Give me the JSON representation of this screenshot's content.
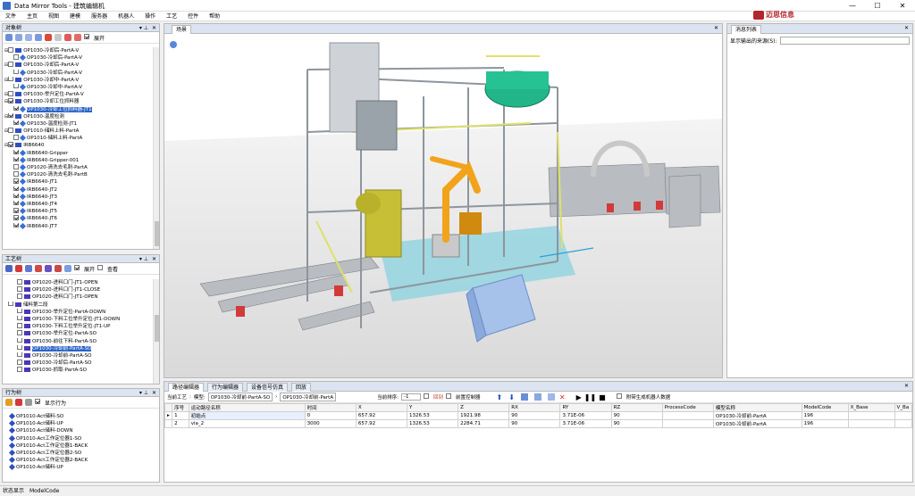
{
  "window": {
    "title": "Data Mirror Tools - 建筑编辑机",
    "min": "—",
    "max": "☐",
    "close": "✕"
  },
  "menu": [
    "文件",
    "主页",
    "视图",
    "建模",
    "服务器",
    "机器人",
    "操作",
    "工艺",
    "控件",
    "帮助"
  ],
  "logo_text": "迈思信息",
  "object_tree": {
    "title": "对象树",
    "show_label": "展开",
    "items": [
      {
        "text": "OP1030-冷却后-PartA-V",
        "check": false,
        "kind": "fold",
        "indent": 0
      },
      {
        "text": "OP1030-冷却后-PartA-V",
        "check": false,
        "kind": "dia",
        "indent": 1
      },
      {
        "text": "OP1030-冷却后-PartA-V",
        "check": false,
        "kind": "fold",
        "indent": 0
      },
      {
        "text": "OP1030-冷却后-PartA-V",
        "check": false,
        "kind": "dia",
        "indent": 1
      },
      {
        "text": "OP1030-冷却中-PartA-V",
        "check": false,
        "kind": "fold",
        "indent": 0
      },
      {
        "text": "OP1030-冷却中-PartA-V",
        "check": false,
        "kind": "dia",
        "indent": 1
      },
      {
        "text": "OP1030-举升定位-PartA-V",
        "check": false,
        "kind": "fold",
        "indent": 0
      },
      {
        "text": "OP1030-冷却工位抓料器",
        "check": true,
        "kind": "fold",
        "indent": 0
      },
      {
        "text": "OP1030-冷却工位抓料器-JT1",
        "check": true,
        "kind": "dia",
        "indent": 1,
        "selected": true
      },
      {
        "text": "OP1030-温度检测",
        "check": true,
        "kind": "fold",
        "indent": 0
      },
      {
        "text": "OP1030-温度检测-JT1",
        "check": true,
        "kind": "dia",
        "indent": 1
      },
      {
        "text": "OP1010-储料上料-PartA",
        "check": false,
        "kind": "fold",
        "indent": 0
      },
      {
        "text": "OP1010-储料上料-PartA",
        "check": false,
        "kind": "dia",
        "indent": 1
      },
      {
        "text": "IRB6640",
        "check": true,
        "kind": "fold",
        "indent": 0
      },
      {
        "text": "IRB6640-Gripper",
        "check": true,
        "kind": "dia",
        "indent": 1
      },
      {
        "text": "IRB6640-Gripper-001",
        "check": true,
        "kind": "dia",
        "indent": 1
      },
      {
        "text": "OP1020-清洗去毛刺-PartA",
        "check": false,
        "kind": "dia",
        "indent": 1
      },
      {
        "text": "OP1020-清洗去毛刺-PartB",
        "check": false,
        "kind": "dia",
        "indent": 1
      },
      {
        "text": "IRB6640-JT1",
        "check": true,
        "kind": "dia",
        "indent": 1
      },
      {
        "text": "IRB6640-JT2",
        "check": true,
        "kind": "dia",
        "indent": 1
      },
      {
        "text": "IRB6640-JT3",
        "check": true,
        "kind": "dia",
        "indent": 1
      },
      {
        "text": "IRB6640-JT4",
        "check": true,
        "kind": "dia",
        "indent": 1
      },
      {
        "text": "IRB6640-JT5",
        "check": true,
        "kind": "dia",
        "indent": 1
      },
      {
        "text": "IRB6640-JT6",
        "check": true,
        "kind": "dia",
        "indent": 1
      },
      {
        "text": "IRB6640-JT7",
        "check": true,
        "kind": "dia",
        "indent": 1
      }
    ]
  },
  "process_tree": {
    "title": "工艺树",
    "expand_label": "展开",
    "view_label": "查看",
    "items": [
      {
        "text": "OP1020-进料口门-JT1-OPEN",
        "indent": 1
      },
      {
        "text": "OP1020-进料口门-JT1-CLOSE",
        "indent": 1
      },
      {
        "text": "OP1020-进料口门-JT1-OPEN",
        "indent": 1
      },
      {
        "text": "储料第二段",
        "indent": 0
      },
      {
        "text": "OP1030-举升定位-PartA-DOWN",
        "indent": 1
      },
      {
        "text": "OP1030-下料工位举升定位-JT1-DOWN",
        "indent": 1
      },
      {
        "text": "OP1030-下料工位举升定位-JT1-UP",
        "indent": 1
      },
      {
        "text": "OP1030-举升定位-PartA-SO",
        "indent": 1
      },
      {
        "text": "OP1030-前往下料-PartA-SO",
        "indent": 1
      },
      {
        "text": "OP1030-冷却前-PartA-SO",
        "indent": 1,
        "selected": true
      },
      {
        "text": "OP1030-冷却前-PartA-SO",
        "indent": 1
      },
      {
        "text": "OP1030-冷却后-PartA-SO",
        "indent": 1
      },
      {
        "text": "OP1030-抓取-PartA-SO",
        "indent": 1
      }
    ]
  },
  "behavior_tree": {
    "title": "行为树",
    "show_behavior": "显示行为",
    "items": [
      "OP1010-Act储料-SO",
      "OP1010-Act储料-UP",
      "OP1010-Act储料-DOWN",
      "OP1010-Act工作定位器1-SO",
      "OP1010-Act工作定位器1-BACK",
      "OP1010-Act工作定位器2-SO",
      "OP1010-Act工作定位器2-BACK",
      "OP1010-Act储料-UP"
    ]
  },
  "viewport": {
    "tab": "场景"
  },
  "messages": {
    "title": "消息列表",
    "filter_label": "显示输出的来源(S):"
  },
  "path_editor": {
    "tabs": [
      "路径编辑器",
      "行为编辑器",
      "设备信号仿真",
      "回放"
    ],
    "breadcrumb_label": "当前工艺",
    "breadcrumb_model": "模型:",
    "breadcrumb_a": "OP1030-冷却前-PartA-SO",
    "breadcrumb_b": "OP1030-冷却前-PartA",
    "sort_label": "当前排序:",
    "sort_value": "-1",
    "ref_label": "回到",
    "ctrl_label": "前置控制器",
    "export_label": "附带生成机器人数据",
    "columns": [
      "序号",
      "运动路径名称",
      "时间",
      "X",
      "Y",
      "Z",
      "RX",
      "RY",
      "RZ",
      "ProcessCode",
      "模型名称",
      "ModelCode",
      "X_Base",
      "V_Ba"
    ],
    "rows": [
      [
        "1",
        "初始点",
        "0",
        "657.92",
        "1326.53",
        "1921.98",
        "90",
        "3.71E-06",
        "90",
        "",
        "OP1030-冷却前-PartA",
        "196",
        "",
        ""
      ],
      [
        "2",
        "via_2",
        "3000",
        "657.92",
        "1326.53",
        "2284.71",
        "90",
        "3.71E-06",
        "90",
        "",
        "OP1030-冷却前-PartA",
        "196",
        "",
        ""
      ]
    ]
  },
  "status": {
    "text": "状态显示",
    "code": "ModelCode"
  },
  "colors": {
    "accent": "#2a64c8",
    "panel_header": "#dbe4f0",
    "floor": "#e6e6e6",
    "sky": "#ffffff"
  }
}
